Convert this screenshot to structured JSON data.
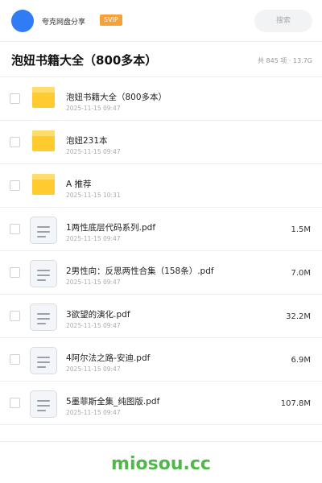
{
  "header": {
    "share_name": "夸克网盘分享",
    "badge": "SVIP",
    "search_placeholder": "搜索"
  },
  "folder": {
    "title": "泡妞书籍大全（800多本）",
    "stats": "共 845 项 · 13.7G"
  },
  "colors": {
    "accent_blue": "#2f7cf6",
    "svip_orange": "#f7a13a",
    "folder_yellow": "#ffcb2e",
    "watermark_green": "#52b74b"
  },
  "files": [
    {
      "name": "泡妞书籍大全（800多本）",
      "date": "2025-11-15 09:47",
      "size": "",
      "icon": "folder-icon"
    },
    {
      "name": "泡妞231本",
      "date": "2025-11-15 09:47",
      "size": "",
      "icon": "folder-icon"
    },
    {
      "name": "A 推荐",
      "date": "2025-11-15 10:31",
      "size": "",
      "icon": "folder-icon"
    },
    {
      "name": "1两性底层代码系列.pdf",
      "date": "2025-11-15 09:47",
      "size": "1.5M",
      "icon": "document-icon"
    },
    {
      "name": "2男性向：反思两性合集（158条）.pdf",
      "date": "2025-11-15 09:47",
      "size": "7.0M",
      "icon": "document-icon"
    },
    {
      "name": "3欲望的演化.pdf",
      "date": "2025-11-15 09:47",
      "size": "32.2M",
      "icon": "document-icon"
    },
    {
      "name": "4阿尔法之路-安迪.pdf",
      "date": "2025-11-15 09:47",
      "size": "6.9M",
      "icon": "document-icon"
    },
    {
      "name": "5墨菲斯全集_纯图版.pdf",
      "date": "2025-11-15 09:47",
      "size": "107.8M",
      "icon": "document-icon"
    }
  ],
  "watermark": "miosou.cc"
}
